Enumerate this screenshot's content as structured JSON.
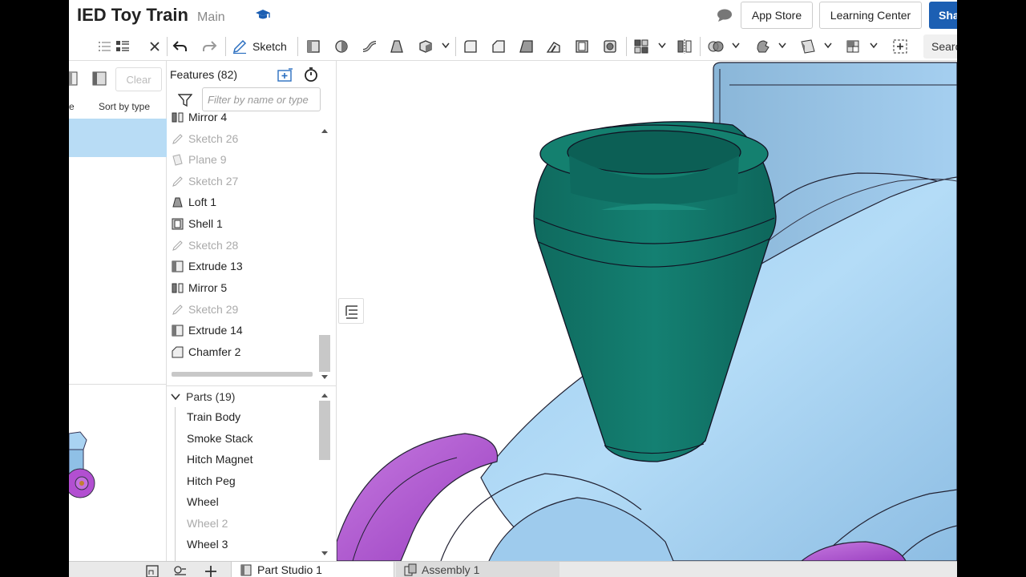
{
  "document": {
    "title": "IED Toy Train",
    "branch": "Main"
  },
  "top_buttons": {
    "app_store": "App Store",
    "learning_center": "Learning Center",
    "share": "Share"
  },
  "toolbar": {
    "sketch_label": "Sketch",
    "search_label": "Search"
  },
  "left_panel": {
    "clear_label": "Clear",
    "sort_label": "Sort by type",
    "column_fragment": "e"
  },
  "feature_panel": {
    "title": "Features (82)",
    "filter_placeholder": "Filter by name or type",
    "items": [
      {
        "label": "Mirror 4",
        "state": "active",
        "icon": "mirror-icon"
      },
      {
        "label": "Sketch 26",
        "state": "suppressed",
        "icon": "sketch-icon"
      },
      {
        "label": "Plane 9",
        "state": "suppressed",
        "icon": "plane-icon"
      },
      {
        "label": "Sketch 27",
        "state": "suppressed",
        "icon": "sketch-icon"
      },
      {
        "label": "Loft 1",
        "state": "active",
        "icon": "loft-icon"
      },
      {
        "label": "Shell 1",
        "state": "active",
        "icon": "shell-icon"
      },
      {
        "label": "Sketch 28",
        "state": "suppressed",
        "icon": "sketch-icon"
      },
      {
        "label": "Extrude 13",
        "state": "active",
        "icon": "extrude-icon"
      },
      {
        "label": "Mirror 5",
        "state": "active",
        "icon": "mirror-icon"
      },
      {
        "label": "Sketch 29",
        "state": "suppressed",
        "icon": "sketch-icon"
      },
      {
        "label": "Extrude 14",
        "state": "active",
        "icon": "extrude-icon"
      },
      {
        "label": "Chamfer 2",
        "state": "active",
        "icon": "chamfer-icon"
      }
    ]
  },
  "parts": {
    "header": "Parts (19)",
    "items": [
      {
        "label": "Train Body",
        "dim": false
      },
      {
        "label": "Smoke Stack",
        "dim": false
      },
      {
        "label": "Hitch Magnet",
        "dim": false
      },
      {
        "label": "Hitch Peg",
        "dim": false
      },
      {
        "label": "Wheel",
        "dim": false
      },
      {
        "label": "Wheel 2",
        "dim": true
      },
      {
        "label": "Wheel 3",
        "dim": false
      }
    ]
  },
  "bottom_tabs": [
    {
      "label": "Part Studio 1",
      "active": true
    },
    {
      "label": "Assembly 1",
      "active": false
    }
  ],
  "colors": {
    "body_blue": "#a9d3f2",
    "smokestack_teal": "#127a6d",
    "wheel_magenta": "#b24fd1",
    "selection_blue": "#b8dcf5",
    "share_blue": "#1c5fb3"
  }
}
